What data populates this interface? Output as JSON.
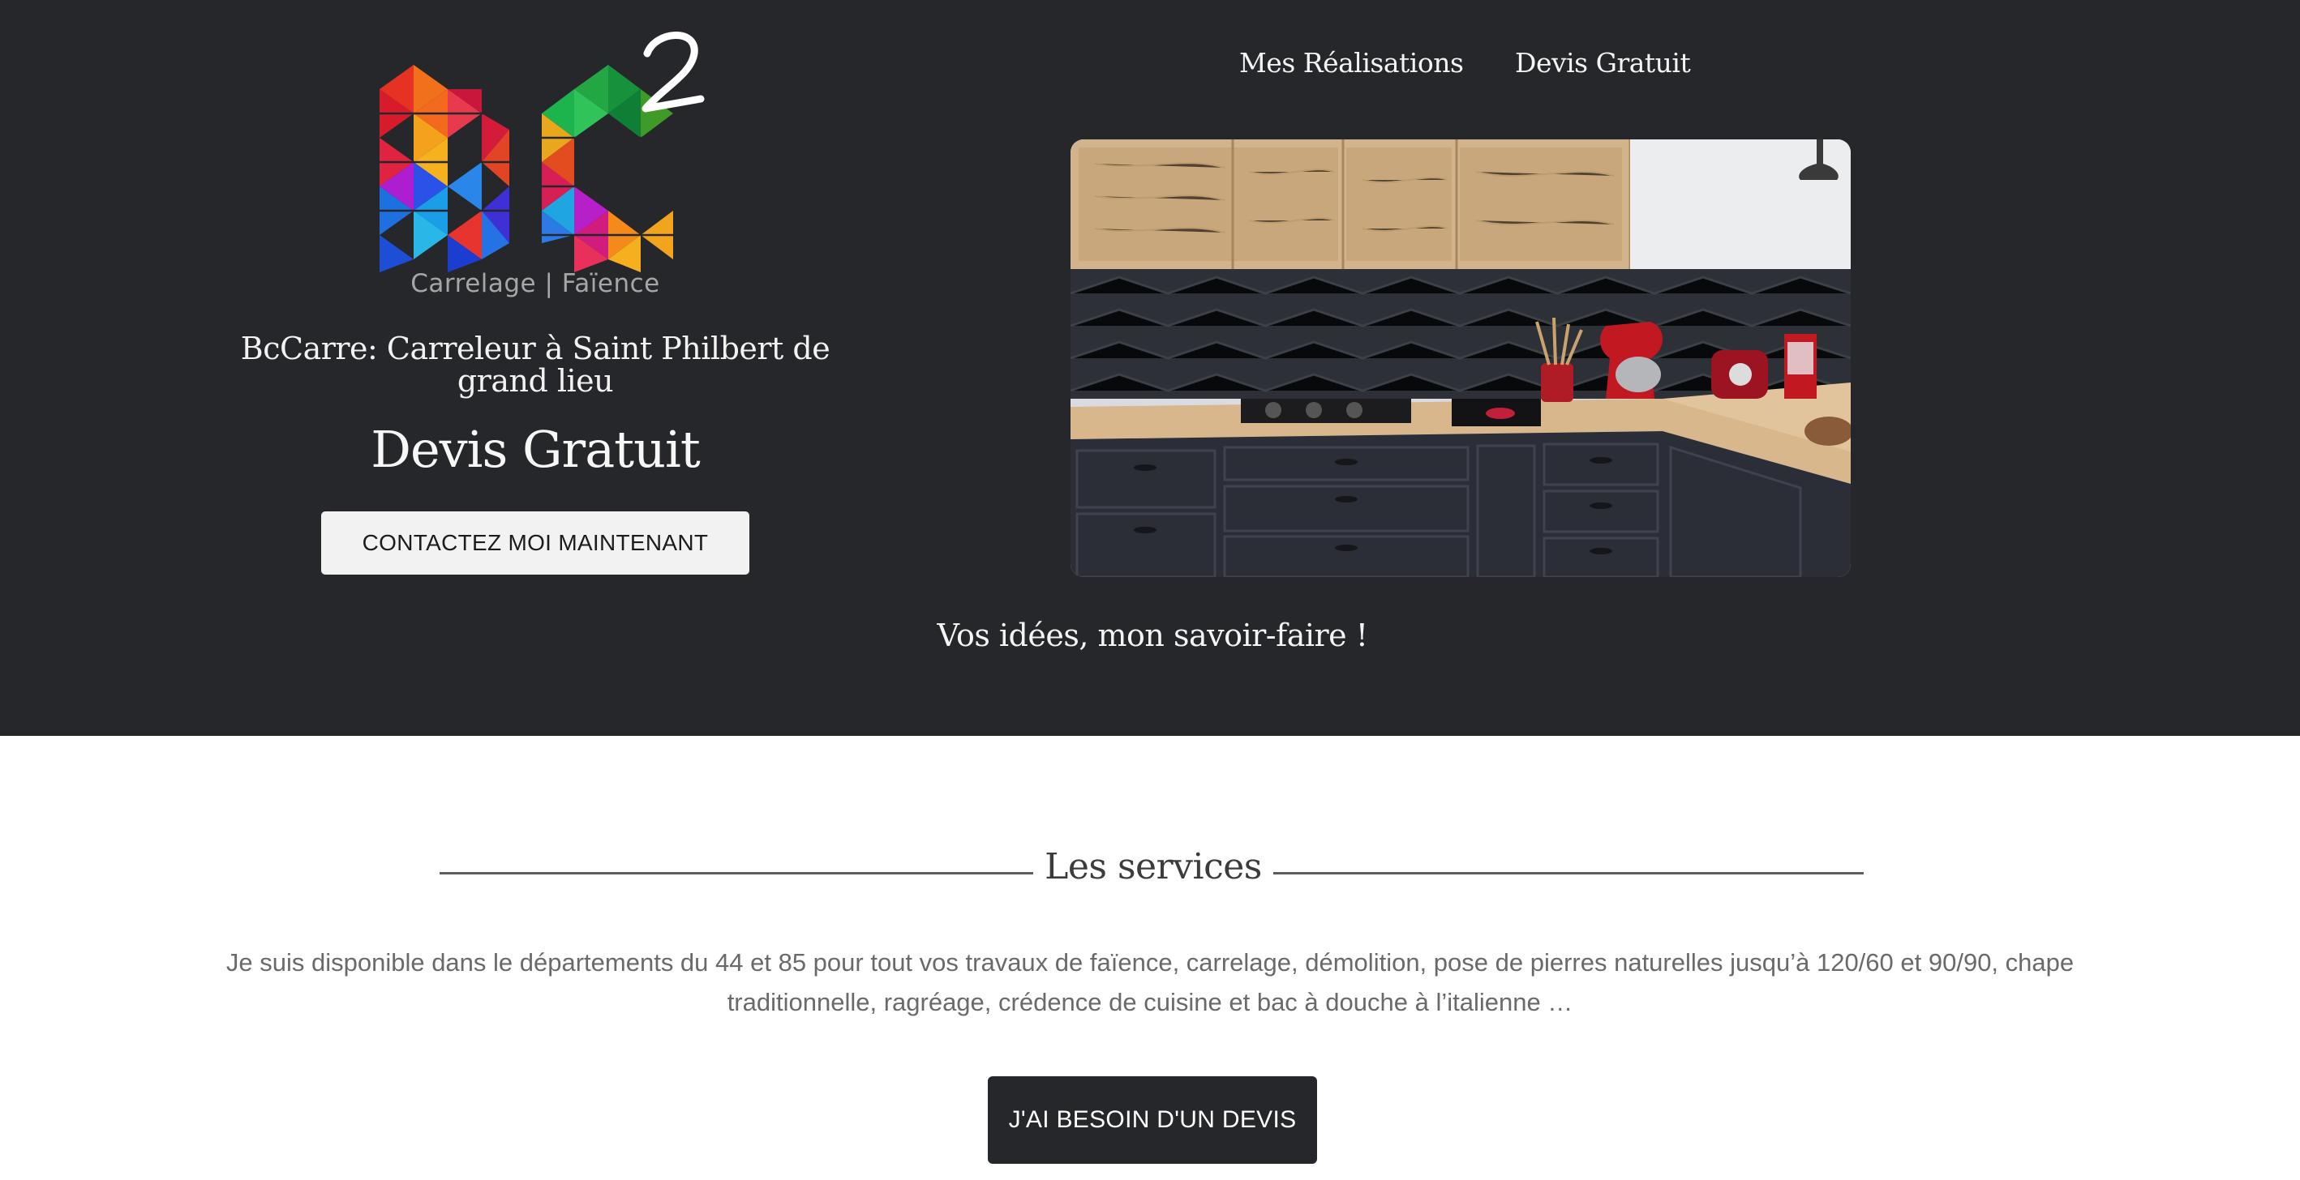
{
  "nav": {
    "realisations_label": "Mes Réalisations",
    "devis_label": "Devis Gratuit"
  },
  "logo": {
    "tagline": "Carrelage | Faïence",
    "icon": "bc2-logo-icon"
  },
  "hero": {
    "title": "BcCarre: Carreleur à Saint Philbert de grand lieu",
    "devis_heading": "Devis Gratuit",
    "contact_button": "CONTACTEZ MOI MAINTENANT",
    "tagline": "Vos idées, mon savoir-faire !",
    "image": "kitchen-photo"
  },
  "services": {
    "title": "Les services",
    "text": "Je suis disponible dans le départements du 44 et 85 pour tout vos travaux de faïence, carrelage, démolition, pose de pierres naturelles jusqu’à 120/60 et 90/90, chape traditionnelle, ragréage, crédence de cuisine et bac à douche à l’italienne …",
    "button": "J'AI BESOIN D'UN DEVIS"
  },
  "colors": {
    "hero_background": "#26272b",
    "page_background": "#ffffff",
    "button_light": "#f2f2f2",
    "button_dark": "#26272b"
  }
}
